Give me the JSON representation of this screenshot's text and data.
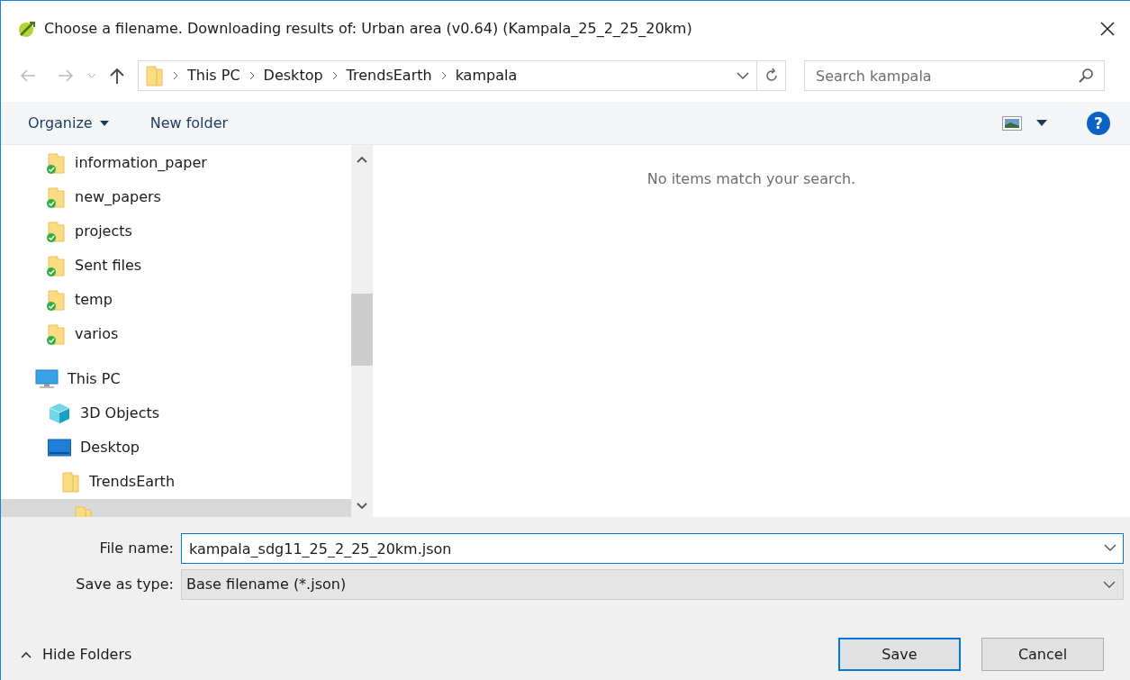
{
  "window": {
    "title": "Choose a filename. Downloading results of: Urban area (v0.64) (Kampala_25_2_25_20km)"
  },
  "address_bar": {
    "crumbs": [
      "This PC",
      "Desktop",
      "TrendsEarth",
      "kampala"
    ]
  },
  "search": {
    "placeholder": "Search kampala"
  },
  "toolbar": {
    "organize": "Organize",
    "new_folder": "New folder",
    "help": "?"
  },
  "sidebar": {
    "items": [
      {
        "label": "information_paper",
        "kind": "synced-folder",
        "selected": false
      },
      {
        "label": "new_papers",
        "kind": "synced-folder",
        "selected": false
      },
      {
        "label": "projects",
        "kind": "synced-folder",
        "selected": false
      },
      {
        "label": "Sent files",
        "kind": "synced-folder",
        "selected": false
      },
      {
        "label": "temp",
        "kind": "synced-folder",
        "selected": false
      },
      {
        "label": "varios",
        "kind": "synced-folder",
        "selected": false
      },
      {
        "label": "This PC",
        "kind": "pc",
        "selected": false,
        "children": [
          {
            "label": "3D Objects",
            "kind": "objects",
            "selected": false
          },
          {
            "label": "Desktop",
            "kind": "desktop",
            "selected": false,
            "children": [
              {
                "label": "TrendsEarth",
                "kind": "folder",
                "selected": false,
                "children": [
                  {
                    "kind": "folder",
                    "selected": true
                  }
                ]
              }
            ]
          }
        ]
      }
    ]
  },
  "content": {
    "empty_message": "No items match your search."
  },
  "file_name": {
    "label": "File name:",
    "value": "kampala_sdg11_25_2_25_20km.json"
  },
  "save_type": {
    "label": "Save as type:",
    "value": "Base filename (*.json)"
  },
  "hide_folders": "Hide Folders",
  "buttons": [
    {
      "label": "Save",
      "kind": "primary"
    },
    {
      "label": "Cancel",
      "kind": "secondary"
    }
  ]
}
